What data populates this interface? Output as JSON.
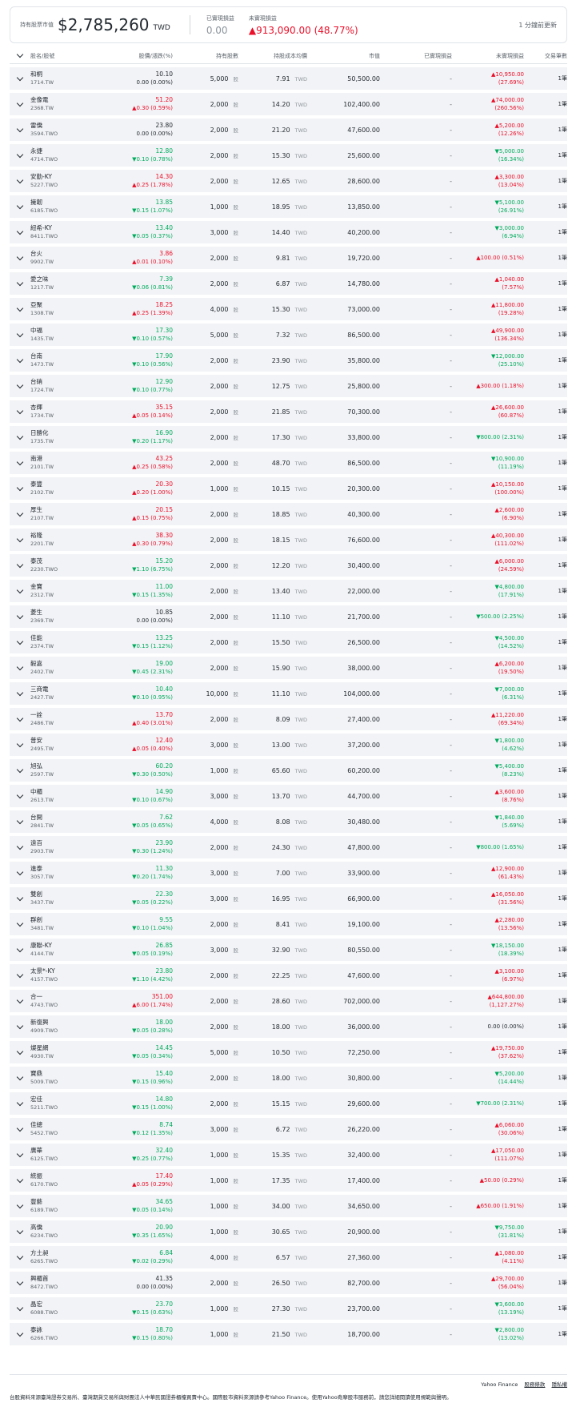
{
  "summary": {
    "holding_label": "持有股票市值",
    "holding_value": "$2,785,260",
    "currency": "TWD",
    "realized_label": "已實現損益",
    "realized_value": "0.00",
    "unrealized_label": "未實現損益",
    "unrealized_value": "▲913,090.00 (48.77%)",
    "refresh": "1 分鐘前更新"
  },
  "headers": {
    "name": "股名/股號",
    "price": "股價/漲跌(%)",
    "shares": "持有股數",
    "cost": "持股成本均價",
    "market_value": "市值",
    "realized": "已實現損益",
    "unrealized": "未實現損益",
    "trades": "交易筆數"
  },
  "share_unit": "股",
  "cost_unit": "TWD",
  "rows": [
    {
      "name": "和桐",
      "sym": "1714.TW",
      "price": "10.10",
      "chg": "0.00 (0.00%)",
      "dir": "flat",
      "shares": "5,000",
      "cost": "7.91",
      "mv": "50,500.00",
      "real": "-",
      "ua": "▲10,950.00",
      "ub": "(27.69%)",
      "udir": "up",
      "trades": "1筆"
    },
    {
      "name": "金像電",
      "sym": "2368.TW",
      "price": "51.20",
      "chg": "▲0.30 (0.59%)",
      "dir": "up",
      "shares": "2,000",
      "cost": "14.20",
      "mv": "102,400.00",
      "real": "-",
      "ua": "▲74,000.00",
      "ub": "(260.56%)",
      "udir": "up",
      "trades": "1筆"
    },
    {
      "name": "雷僑",
      "sym": "3594.TWO",
      "price": "23.80",
      "chg": "0.00 (0.00%)",
      "dir": "flat",
      "shares": "2,000",
      "cost": "21.20",
      "mv": "47,600.00",
      "real": "-",
      "ua": "▲5,200.00",
      "ub": "(12.26%)",
      "udir": "up",
      "trades": "1筆"
    },
    {
      "name": "永捷",
      "sym": "4714.TWO",
      "price": "12.80",
      "chg": "▼0.10 (0.78%)",
      "dir": "down",
      "shares": "2,000",
      "cost": "15.30",
      "mv": "25,600.00",
      "real": "-",
      "ua": "▼5,000.00",
      "ub": "(16.34%)",
      "udir": "down",
      "trades": "1筆"
    },
    {
      "name": "安勤-KY",
      "sym": "5227.TWO",
      "price": "14.30",
      "chg": "▲0.25 (1.78%)",
      "dir": "up",
      "shares": "2,000",
      "cost": "12.65",
      "mv": "28,600.00",
      "real": "-",
      "ua": "▲3,300.00",
      "ub": "(13.04%)",
      "udir": "up",
      "trades": "1筆"
    },
    {
      "name": "擁韌",
      "sym": "6185.TWO",
      "price": "13.85",
      "chg": "▼0.15 (1.07%)",
      "dir": "down",
      "shares": "1,000",
      "cost": "18.95",
      "mv": "13,850.00",
      "real": "-",
      "ua": "▼5,100.00",
      "ub": "(26.91%)",
      "udir": "down",
      "trades": "1筆"
    },
    {
      "name": "紐希-KY",
      "sym": "8411.TWO",
      "price": "13.40",
      "chg": "▼0.05 (0.37%)",
      "dir": "down",
      "shares": "3,000",
      "cost": "14.40",
      "mv": "40,200.00",
      "real": "-",
      "ua": "▼3,000.00",
      "ub": "(6.94%)",
      "udir": "down",
      "trades": "1筆"
    },
    {
      "name": "台火",
      "sym": "9902.TW",
      "price": "3.86",
      "chg": "▲0.01 (0.10%)",
      "dir": "up",
      "shares": "2,000",
      "cost": "9.81",
      "mv": "19,720.00",
      "real": "-",
      "ua": "▲100.00 (0.51%)",
      "ub": "",
      "udir": "up",
      "trades": "1筆"
    },
    {
      "name": "愛之味",
      "sym": "1217.TW",
      "price": "7.39",
      "chg": "▼0.06 (0.81%)",
      "dir": "down",
      "shares": "2,000",
      "cost": "6.87",
      "mv": "14,780.00",
      "real": "-",
      "ua": "▲1,040.00",
      "ub": "(7.57%)",
      "udir": "up",
      "trades": "1筆"
    },
    {
      "name": "亞聚",
      "sym": "1308.TW",
      "price": "18.25",
      "chg": "▲0.25 (1.39%)",
      "dir": "up",
      "shares": "4,000",
      "cost": "15.30",
      "mv": "73,000.00",
      "real": "-",
      "ua": "▲11,800.00",
      "ub": "(19.28%)",
      "udir": "up",
      "trades": "1筆"
    },
    {
      "name": "中福",
      "sym": "1435.TW",
      "price": "17.30",
      "chg": "▼0.10 (0.57%)",
      "dir": "down",
      "shares": "5,000",
      "cost": "7.32",
      "mv": "86,500.00",
      "real": "-",
      "ua": "▲49,900.00",
      "ub": "(136.34%)",
      "udir": "up",
      "trades": "1筆"
    },
    {
      "name": "台南",
      "sym": "1473.TW",
      "price": "17.90",
      "chg": "▼0.10 (0.56%)",
      "dir": "down",
      "shares": "2,000",
      "cost": "23.90",
      "mv": "35,800.00",
      "real": "-",
      "ua": "▼12,000.00",
      "ub": "(25.10%)",
      "udir": "down",
      "trades": "1筆"
    },
    {
      "name": "台硝",
      "sym": "1724.TW",
      "price": "12.90",
      "chg": "▼0.10 (0.77%)",
      "dir": "down",
      "shares": "2,000",
      "cost": "12.75",
      "mv": "25,800.00",
      "real": "-",
      "ua": "▲300.00 (1.18%)",
      "ub": "",
      "udir": "up",
      "trades": "1筆"
    },
    {
      "name": "杏輝",
      "sym": "1734.TW",
      "price": "35.15",
      "chg": "▲0.05 (0.14%)",
      "dir": "up",
      "shares": "2,000",
      "cost": "21.85",
      "mv": "70,300.00",
      "real": "-",
      "ua": "▲26,600.00",
      "ub": "(60.87%)",
      "udir": "up",
      "trades": "1筆"
    },
    {
      "name": "日勝化",
      "sym": "1735.TW",
      "price": "16.90",
      "chg": "▼0.20 (1.17%)",
      "dir": "down",
      "shares": "2,000",
      "cost": "17.30",
      "mv": "33,800.00",
      "real": "-",
      "ua": "▼800.00 (2.31%)",
      "ub": "",
      "udir": "down",
      "trades": "1筆"
    },
    {
      "name": "南港",
      "sym": "2101.TW",
      "price": "43.25",
      "chg": "▲0.25 (0.58%)",
      "dir": "up",
      "shares": "2,000",
      "cost": "48.70",
      "mv": "86,500.00",
      "real": "-",
      "ua": "▼10,900.00",
      "ub": "(11.19%)",
      "udir": "down",
      "trades": "1筆"
    },
    {
      "name": "泰豐",
      "sym": "2102.TW",
      "price": "20.30",
      "chg": "▲0.20 (1.00%)",
      "dir": "up",
      "shares": "1,000",
      "cost": "10.15",
      "mv": "20,300.00",
      "real": "-",
      "ua": "▲10,150.00",
      "ub": "(100.00%)",
      "udir": "up",
      "trades": "1筆"
    },
    {
      "name": "厚生",
      "sym": "2107.TW",
      "price": "20.15",
      "chg": "▲0.15 (0.75%)",
      "dir": "up",
      "shares": "2,000",
      "cost": "18.85",
      "mv": "40,300.00",
      "real": "-",
      "ua": "▲2,600.00",
      "ub": "(6.90%)",
      "udir": "up",
      "trades": "1筆"
    },
    {
      "name": "裕隆",
      "sym": "2201.TW",
      "price": "38.30",
      "chg": "▲0.30 (0.79%)",
      "dir": "up",
      "shares": "2,000",
      "cost": "18.15",
      "mv": "76,600.00",
      "real": "-",
      "ua": "▲40,300.00",
      "ub": "(111.02%)",
      "udir": "up",
      "trades": "1筆"
    },
    {
      "name": "泰茂",
      "sym": "2230.TWO",
      "price": "15.20",
      "chg": "▼1.10 (6.75%)",
      "dir": "down",
      "shares": "2,000",
      "cost": "12.20",
      "mv": "30,400.00",
      "real": "-",
      "ua": "▲6,000.00",
      "ub": "(24.59%)",
      "udir": "up",
      "trades": "1筆"
    },
    {
      "name": "金寶",
      "sym": "2312.TW",
      "price": "11.00",
      "chg": "▼0.15 (1.35%)",
      "dir": "down",
      "shares": "2,000",
      "cost": "13.40",
      "mv": "22,000.00",
      "real": "-",
      "ua": "▼4,800.00",
      "ub": "(17.91%)",
      "udir": "down",
      "trades": "1筆"
    },
    {
      "name": "菱生",
      "sym": "2369.TW",
      "price": "10.85",
      "chg": "0.00 (0.00%)",
      "dir": "flat",
      "shares": "2,000",
      "cost": "11.10",
      "mv": "21,700.00",
      "real": "-",
      "ua": "▼500.00 (2.25%)",
      "ub": "",
      "udir": "down",
      "trades": "1筆"
    },
    {
      "name": "佳能",
      "sym": "2374.TW",
      "price": "13.25",
      "chg": "▼0.15 (1.12%)",
      "dir": "down",
      "shares": "2,000",
      "cost": "15.50",
      "mv": "26,500.00",
      "real": "-",
      "ua": "▼4,500.00",
      "ub": "(14.52%)",
      "udir": "down",
      "trades": "1筆"
    },
    {
      "name": "毅嘉",
      "sym": "2402.TW",
      "price": "19.00",
      "chg": "▼0.45 (2.31%)",
      "dir": "down",
      "shares": "2,000",
      "cost": "15.90",
      "mv": "38,000.00",
      "real": "-",
      "ua": "▲6,200.00",
      "ub": "(19.50%)",
      "udir": "up",
      "trades": "1筆"
    },
    {
      "name": "三商電",
      "sym": "2427.TW",
      "price": "10.40",
      "chg": "▼0.10 (0.95%)",
      "dir": "down",
      "shares": "10,000",
      "cost": "11.10",
      "mv": "104,000.00",
      "real": "-",
      "ua": "▼7,000.00",
      "ub": "(6.31%)",
      "udir": "down",
      "trades": "1筆"
    },
    {
      "name": "一詮",
      "sym": "2486.TW",
      "price": "13.70",
      "chg": "▲0.40 (3.01%)",
      "dir": "up",
      "shares": "2,000",
      "cost": "8.09",
      "mv": "27,400.00",
      "real": "-",
      "ua": "▲11,220.00",
      "ub": "(69.34%)",
      "udir": "up",
      "trades": "1筆"
    },
    {
      "name": "普安",
      "sym": "2495.TW",
      "price": "12.40",
      "chg": "▲0.05 (0.40%)",
      "dir": "up",
      "shares": "3,000",
      "cost": "13.00",
      "mv": "37,200.00",
      "real": "-",
      "ua": "▼1,800.00",
      "ub": "(4.62%)",
      "udir": "down",
      "trades": "1筆"
    },
    {
      "name": "旭弘",
      "sym": "2597.TW",
      "price": "60.20",
      "chg": "▼0.30 (0.50%)",
      "dir": "down",
      "shares": "1,000",
      "cost": "65.60",
      "mv": "60,200.00",
      "real": "-",
      "ua": "▼5,400.00",
      "ub": "(8.23%)",
      "udir": "down",
      "trades": "1筆"
    },
    {
      "name": "中櫃",
      "sym": "2613.TW",
      "price": "14.90",
      "chg": "▼0.10 (0.67%)",
      "dir": "down",
      "shares": "3,000",
      "cost": "13.70",
      "mv": "44,700.00",
      "real": "-",
      "ua": "▲3,600.00",
      "ub": "(8.76%)",
      "udir": "up",
      "trades": "1筆"
    },
    {
      "name": "台開",
      "sym": "2841.TW",
      "price": "7.62",
      "chg": "▼0.05 (0.65%)",
      "dir": "down",
      "shares": "4,000",
      "cost": "8.08",
      "mv": "30,480.00",
      "real": "-",
      "ua": "▼1,840.00",
      "ub": "(5.69%)",
      "udir": "down",
      "trades": "1筆"
    },
    {
      "name": "遠百",
      "sym": "2903.TW",
      "price": "23.90",
      "chg": "▼0.30 (1.24%)",
      "dir": "down",
      "shares": "2,000",
      "cost": "24.30",
      "mv": "47,800.00",
      "real": "-",
      "ua": "▼800.00 (1.65%)",
      "ub": "",
      "udir": "down",
      "trades": "1筆"
    },
    {
      "name": "進泰",
      "sym": "3057.TW",
      "price": "11.30",
      "chg": "▼0.20 (1.74%)",
      "dir": "down",
      "shares": "3,000",
      "cost": "7.00",
      "mv": "33,900.00",
      "real": "-",
      "ua": "▲12,900.00",
      "ub": "(61.43%)",
      "udir": "up",
      "trades": "1筆"
    },
    {
      "name": "雙創",
      "sym": "3437.TW",
      "price": "22.30",
      "chg": "▼0.05 (0.22%)",
      "dir": "down",
      "shares": "3,000",
      "cost": "16.95",
      "mv": "66,900.00",
      "real": "-",
      "ua": "▲16,050.00",
      "ub": "(31.56%)",
      "udir": "up",
      "trades": "1筆"
    },
    {
      "name": "群創",
      "sym": "3481.TW",
      "price": "9.55",
      "chg": "▼0.10 (1.04%)",
      "dir": "down",
      "shares": "2,000",
      "cost": "8.41",
      "mv": "19,100.00",
      "real": "-",
      "ua": "▲2,280.00",
      "ub": "(13.56%)",
      "udir": "up",
      "trades": "1筆"
    },
    {
      "name": "康聯-KY",
      "sym": "4144.TW",
      "price": "26.85",
      "chg": "▼0.05 (0.19%)",
      "dir": "down",
      "shares": "3,000",
      "cost": "32.90",
      "mv": "80,550.00",
      "real": "-",
      "ua": "▼18,150.00",
      "ub": "(18.39%)",
      "udir": "down",
      "trades": "1筆"
    },
    {
      "name": "太景*-KY",
      "sym": "4157.TWO",
      "price": "23.80",
      "chg": "▼1.10 (4.42%)",
      "dir": "down",
      "shares": "2,000",
      "cost": "22.25",
      "mv": "47,600.00",
      "real": "-",
      "ua": "▲3,100.00",
      "ub": "(6.97%)",
      "udir": "up",
      "trades": "1筆"
    },
    {
      "name": "合一",
      "sym": "4743.TWO",
      "price": "351.00",
      "chg": "▲6.00 (1.74%)",
      "dir": "up",
      "shares": "2,000",
      "cost": "28.60",
      "mv": "702,000.00",
      "real": "-",
      "ua": "▲644,800.00",
      "ub": "(1,127.27%)",
      "udir": "up",
      "trades": "1筆"
    },
    {
      "name": "新復興",
      "sym": "4909.TWO",
      "price": "18.00",
      "chg": "▼0.05 (0.28%)",
      "dir": "down",
      "shares": "2,000",
      "cost": "18.00",
      "mv": "36,000.00",
      "real": "-",
      "ua": "0.00 (0.00%)",
      "ub": "",
      "udir": "flat",
      "trades": "1筆"
    },
    {
      "name": "燦星網",
      "sym": "4930.TW",
      "price": "14.45",
      "chg": "▼0.05 (0.34%)",
      "dir": "down",
      "shares": "5,000",
      "cost": "10.50",
      "mv": "72,250.00",
      "real": "-",
      "ua": "▲19,750.00",
      "ub": "(37.62%)",
      "udir": "up",
      "trades": "1筆"
    },
    {
      "name": "寶鼎",
      "sym": "5009.TWO",
      "price": "15.40",
      "chg": "▼0.15 (0.96%)",
      "dir": "down",
      "shares": "2,000",
      "cost": "18.00",
      "mv": "30,800.00",
      "real": "-",
      "ua": "▼5,200.00",
      "ub": "(14.44%)",
      "udir": "down",
      "trades": "1筆"
    },
    {
      "name": "宏佳",
      "sym": "5211.TWO",
      "price": "14.80",
      "chg": "▼0.15 (1.00%)",
      "dir": "down",
      "shares": "2,000",
      "cost": "15.15",
      "mv": "29,600.00",
      "real": "-",
      "ua": "▼700.00 (2.31%)",
      "ub": "",
      "udir": "down",
      "trades": "1筆"
    },
    {
      "name": "佳總",
      "sym": "5452.TWO",
      "price": "8.74",
      "chg": "▼0.12 (1.35%)",
      "dir": "down",
      "shares": "3,000",
      "cost": "6.72",
      "mv": "26,220.00",
      "real": "-",
      "ua": "▲6,060.00",
      "ub": "(30.06%)",
      "udir": "up",
      "trades": "1筆"
    },
    {
      "name": "廣華",
      "sym": "6125.TWO",
      "price": "32.40",
      "chg": "▼0.25 (0.77%)",
      "dir": "down",
      "shares": "1,000",
      "cost": "15.35",
      "mv": "32,400.00",
      "real": "-",
      "ua": "▲17,050.00",
      "ub": "(111.07%)",
      "udir": "up",
      "trades": "1筆"
    },
    {
      "name": "統振",
      "sym": "6170.TWO",
      "price": "17.40",
      "chg": "▲0.05 (0.29%)",
      "dir": "up",
      "shares": "1,000",
      "cost": "17.35",
      "mv": "17,400.00",
      "real": "-",
      "ua": "▲50.00 (0.29%)",
      "ub": "",
      "udir": "up",
      "trades": "1筆"
    },
    {
      "name": "豐藝",
      "sym": "6189.TWO",
      "price": "34.65",
      "chg": "▼0.05 (0.14%)",
      "dir": "down",
      "shares": "1,000",
      "cost": "34.00",
      "mv": "34,650.00",
      "real": "-",
      "ua": "▲650.00 (1.91%)",
      "ub": "",
      "udir": "up",
      "trades": "1筆"
    },
    {
      "name": "高僑",
      "sym": "6234.TWO",
      "price": "20.90",
      "chg": "▼0.35 (1.65%)",
      "dir": "down",
      "shares": "1,000",
      "cost": "30.65",
      "mv": "20,900.00",
      "real": "-",
      "ua": "▼9,750.00",
      "ub": "(31.81%)",
      "udir": "down",
      "trades": "1筆"
    },
    {
      "name": "方土昶",
      "sym": "6265.TWO",
      "price": "6.84",
      "chg": "▼0.02 (0.29%)",
      "dir": "down",
      "shares": "4,000",
      "cost": "6.57",
      "mv": "27,360.00",
      "real": "-",
      "ua": "▲1,080.00",
      "ub": "(4.11%)",
      "udir": "up",
      "trades": "1筆"
    },
    {
      "name": "興櫃首",
      "sym": "8472.TWO",
      "price": "41.35",
      "chg": "0.00 (0.00%)",
      "dir": "flat",
      "shares": "2,000",
      "cost": "26.50",
      "mv": "82,700.00",
      "real": "-",
      "ua": "▲29,700.00",
      "ub": "(56.04%)",
      "udir": "up",
      "trades": "1筆"
    },
    {
      "name": "晶宏",
      "sym": "6088.TWO",
      "price": "23.70",
      "chg": "▼0.15 (0.63%)",
      "dir": "down",
      "shares": "1,000",
      "cost": "27.30",
      "mv": "23,700.00",
      "real": "-",
      "ua": "▼3,600.00",
      "ub": "(13.19%)",
      "udir": "down",
      "trades": "1筆"
    },
    {
      "name": "泰詠",
      "sym": "6266.TWO",
      "price": "18.70",
      "chg": "▼0.15 (0.80%)",
      "dir": "down",
      "shares": "1,000",
      "cost": "21.50",
      "mv": "18,700.00",
      "real": "-",
      "ua": "▼2,800.00",
      "ub": "(13.02%)",
      "udir": "down",
      "trades": "1筆"
    }
  ],
  "footer": {
    "text": "台股資料來源臺灣證券交易所、臺灣期貨交易所與財團法人中華民國證券櫃檯買賣中心。國際股市資料來源請參考Yahoo Finance。使用Yahoo奇摩股市服務前，請您詳細閱讀使用規範與聲明。",
    "brand": "Yahoo Finance",
    "link1": "股務條款",
    "link2": "隱私權"
  }
}
